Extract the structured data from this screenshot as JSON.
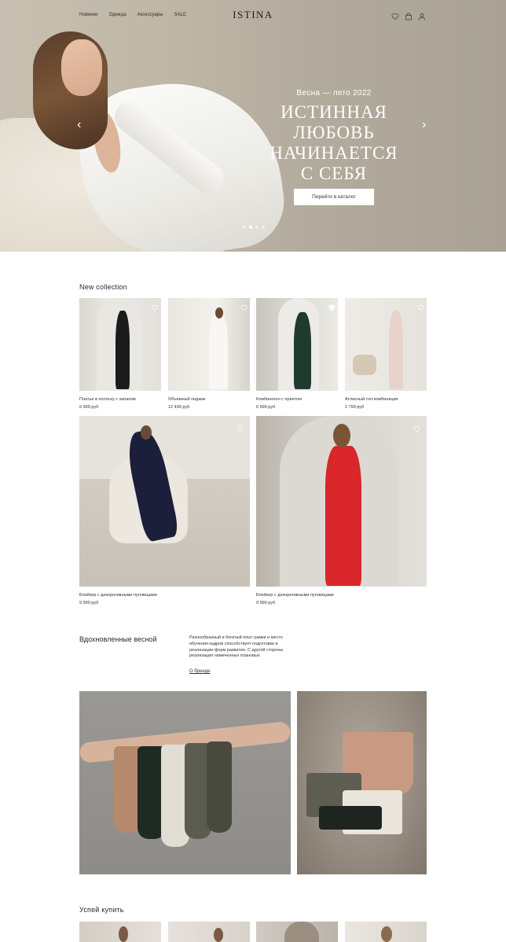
{
  "header": {
    "nav": [
      "Новинки",
      "Одежда",
      "Аксессуары",
      "SALE"
    ],
    "logo": "ISTINA",
    "icons": [
      "heart-icon",
      "bag-icon",
      "user-icon"
    ]
  },
  "hero": {
    "season": "Весна — лето 2022",
    "title_lines": [
      "ИСТИННАЯ",
      "ЛЮБОВЬ",
      "НАЧИНАЕТСЯ",
      "С СЕБЯ"
    ],
    "cta": "Перейти в каталог",
    "slides_count": 4,
    "active_slide": 2,
    "prev_icon": "chevron-left-icon",
    "next_icon": "chevron-right-icon"
  },
  "new_collection": {
    "title": "New collection",
    "products": [
      {
        "name": "Платье в полоску с запахом",
        "price": "6 999 руб",
        "favorited": false
      },
      {
        "name": "Объемный пиджак",
        "price": "12 499 руб",
        "favorited": false
      },
      {
        "name": "Комбинезон с принтом",
        "price": "6 999 руб",
        "favorited": true
      },
      {
        "name": "Атласный топ-комбинация",
        "price": "2 799 руб",
        "favorited": false
      },
      {
        "name": "Блейзер с декоративными пуговицами",
        "price": "9 999 руб",
        "favorited": false
      },
      {
        "name": "Блейзер с декоративными пуговицами",
        "price": "9 999 руб",
        "favorited": false
      }
    ]
  },
  "about": {
    "heading": "Вдохновленные весной",
    "text": "Разнообразный и богатый опыт рамки и место обучения кадров способствует подготовки и реализации форм развития. С другой стороны реализация намеченных плановых",
    "link": "О бренде"
  },
  "hurry": {
    "title": "Успей купить"
  },
  "colors": {
    "hero_bg": "#bfb6a6",
    "text": "#2b2b2b",
    "dress_red": "#d8262a",
    "dress_green": "#1f3a2f",
    "dress_navy": "#1c1f3a"
  }
}
